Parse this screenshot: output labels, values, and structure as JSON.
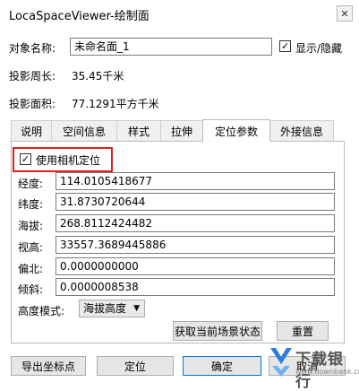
{
  "window": {
    "title": "LocaSpaceViewer-绘制面",
    "close_glyph": "✕"
  },
  "object_name": {
    "label": "对象名称:",
    "value": "未命名面_1"
  },
  "show_hide": {
    "label": "显示/隐藏",
    "checked": true
  },
  "perimeter": {
    "label": "投影周长:",
    "value": "35.45千米"
  },
  "area": {
    "label": "投影面积:",
    "value": "77.1291平方千米"
  },
  "tabs": [
    {
      "label": "说明",
      "active": false
    },
    {
      "label": "空间信息",
      "active": false
    },
    {
      "label": "样式",
      "active": false
    },
    {
      "label": "拉伸",
      "active": false
    },
    {
      "label": "定位参数",
      "active": true
    },
    {
      "label": "外接信息",
      "active": false
    }
  ],
  "camera_checkbox": {
    "label": "使用相机定位",
    "checked": true
  },
  "fields": [
    {
      "label": "经度:",
      "value": "114.0105418677"
    },
    {
      "label": "纬度:",
      "value": "31.8730720644"
    },
    {
      "label": "海拔:",
      "value": "268.8112424482"
    },
    {
      "label": "视高:",
      "value": "33557.3689445886"
    },
    {
      "label": "偏北:",
      "value": "0.0000000000"
    },
    {
      "label": "倾斜:",
      "value": "0.0000008538"
    }
  ],
  "altitude_mode": {
    "label": "高度模式:",
    "value": "海拔高度"
  },
  "buttons": {
    "get_scene_state": "获取当前场景状态",
    "reset": "重置",
    "export_coords": "导出坐标点",
    "locate": "定位",
    "ok": "确定",
    "cancel": "取消"
  },
  "watermark": {
    "brand": "下载银行",
    "url": "www.downbank.cn"
  },
  "colors": {
    "highlight": "#e02020",
    "default_button_border": "#0078d7",
    "brand_blue": "#2a7de1"
  }
}
